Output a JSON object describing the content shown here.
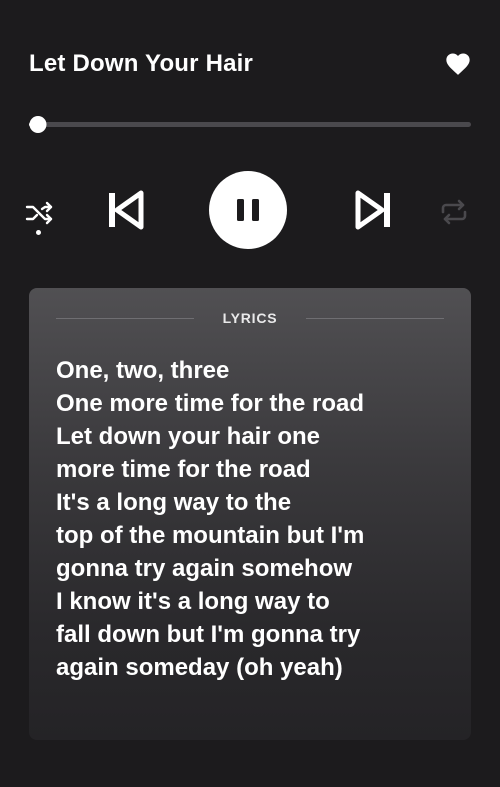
{
  "player": {
    "track_title": "Let Down Your Hair",
    "liked": true,
    "progress": 0.02,
    "is_playing": true,
    "icons": {
      "like": "heart-icon",
      "shuffle": "shuffle-icon",
      "previous": "skip-previous-icon",
      "play_pause": "pause-icon",
      "next": "skip-next-icon",
      "repeat": "repeat-icon"
    },
    "shuffle_active": true,
    "repeat_active": false
  },
  "lyrics": {
    "header": "LYRICS",
    "lines": [
      "One, two, three",
      "One more time for the road",
      "Let down your hair one",
      "more time for the road",
      "It's a long way to the",
      "top of the mountain but I'm",
      "gonna try again somehow",
      "I know it's a long way to",
      "fall down but I'm gonna try",
      "again someday (oh yeah)"
    ]
  },
  "colors": {
    "background": "#1c1b1d",
    "text": "#ffffff",
    "inactive_icon": "#4a494d"
  }
}
